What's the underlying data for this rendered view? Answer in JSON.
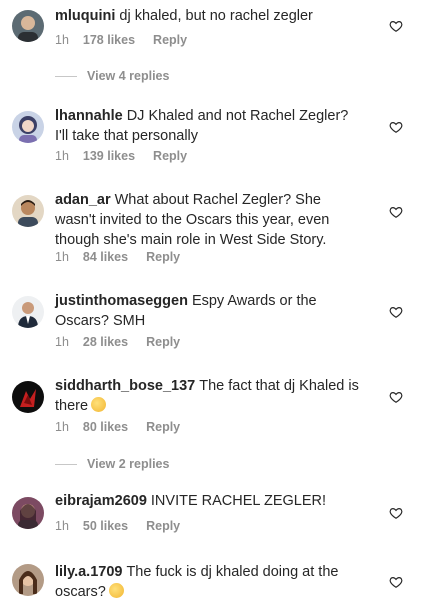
{
  "comments": [
    {
      "username": "mluquini",
      "text": "dj khaled, but no rachel zegler",
      "time": "1h",
      "likes": "178 likes",
      "reply": "Reply"
    },
    {
      "username": "lhannahle",
      "text": "DJ Khaled and not Rachel Zegler? I'll take that personally",
      "time": "1h",
      "likes": "139 likes",
      "reply": "Reply"
    },
    {
      "username": "adan_ar",
      "text": "What about Rachel Zegler? She wasn't invited to the Oscars this year, even though she's main role in West Side Story.",
      "time": "1h",
      "likes": "84 likes",
      "reply": "Reply"
    },
    {
      "username": "justinthomaseggen",
      "text": "Espy Awards or the Oscars? SMH",
      "time": "1h",
      "likes": "28 likes",
      "reply": "Reply"
    },
    {
      "username": "siddharth_bose_137",
      "text": "The fact that dj Khaled is there",
      "time": "1h",
      "likes": "80 likes",
      "reply": "Reply"
    },
    {
      "username": "eibrajam2609",
      "text": "INVITE RACHEL ZEGLER!",
      "time": "1h",
      "likes": "50 likes",
      "reply": "Reply"
    },
    {
      "username": "lily.a.1709",
      "text": "The fuck is dj khaled doing at the oscars?",
      "time": "",
      "likes": "",
      "reply": ""
    }
  ],
  "view_replies": [
    {
      "label": "View 4 replies"
    },
    {
      "label": "View 2 replies"
    }
  ],
  "icons": {
    "like": "heart-outline-icon"
  },
  "colors": {
    "text": "#262626",
    "secondary": "#8e8e8e",
    "divider": "#c7c7c7"
  }
}
